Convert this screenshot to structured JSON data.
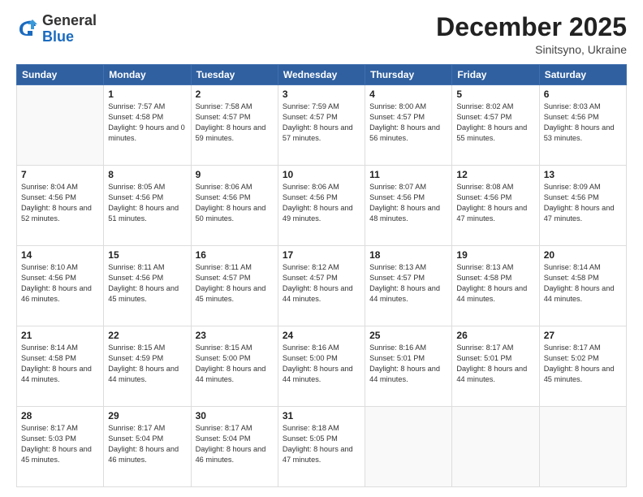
{
  "logo": {
    "general": "General",
    "blue": "Blue"
  },
  "header": {
    "month": "December 2025",
    "location": "Sinitsyno, Ukraine"
  },
  "days_of_week": [
    "Sunday",
    "Monday",
    "Tuesday",
    "Wednesday",
    "Thursday",
    "Friday",
    "Saturday"
  ],
  "weeks": [
    [
      {
        "day": "",
        "sunrise": "",
        "sunset": "",
        "daylight": ""
      },
      {
        "day": "1",
        "sunrise": "Sunrise: 7:57 AM",
        "sunset": "Sunset: 4:58 PM",
        "daylight": "Daylight: 9 hours and 0 minutes."
      },
      {
        "day": "2",
        "sunrise": "Sunrise: 7:58 AM",
        "sunset": "Sunset: 4:57 PM",
        "daylight": "Daylight: 8 hours and 59 minutes."
      },
      {
        "day": "3",
        "sunrise": "Sunrise: 7:59 AM",
        "sunset": "Sunset: 4:57 PM",
        "daylight": "Daylight: 8 hours and 57 minutes."
      },
      {
        "day": "4",
        "sunrise": "Sunrise: 8:00 AM",
        "sunset": "Sunset: 4:57 PM",
        "daylight": "Daylight: 8 hours and 56 minutes."
      },
      {
        "day": "5",
        "sunrise": "Sunrise: 8:02 AM",
        "sunset": "Sunset: 4:57 PM",
        "daylight": "Daylight: 8 hours and 55 minutes."
      },
      {
        "day": "6",
        "sunrise": "Sunrise: 8:03 AM",
        "sunset": "Sunset: 4:56 PM",
        "daylight": "Daylight: 8 hours and 53 minutes."
      }
    ],
    [
      {
        "day": "7",
        "sunrise": "Sunrise: 8:04 AM",
        "sunset": "Sunset: 4:56 PM",
        "daylight": "Daylight: 8 hours and 52 minutes."
      },
      {
        "day": "8",
        "sunrise": "Sunrise: 8:05 AM",
        "sunset": "Sunset: 4:56 PM",
        "daylight": "Daylight: 8 hours and 51 minutes."
      },
      {
        "day": "9",
        "sunrise": "Sunrise: 8:06 AM",
        "sunset": "Sunset: 4:56 PM",
        "daylight": "Daylight: 8 hours and 50 minutes."
      },
      {
        "day": "10",
        "sunrise": "Sunrise: 8:06 AM",
        "sunset": "Sunset: 4:56 PM",
        "daylight": "Daylight: 8 hours and 49 minutes."
      },
      {
        "day": "11",
        "sunrise": "Sunrise: 8:07 AM",
        "sunset": "Sunset: 4:56 PM",
        "daylight": "Daylight: 8 hours and 48 minutes."
      },
      {
        "day": "12",
        "sunrise": "Sunrise: 8:08 AM",
        "sunset": "Sunset: 4:56 PM",
        "daylight": "Daylight: 8 hours and 47 minutes."
      },
      {
        "day": "13",
        "sunrise": "Sunrise: 8:09 AM",
        "sunset": "Sunset: 4:56 PM",
        "daylight": "Daylight: 8 hours and 47 minutes."
      }
    ],
    [
      {
        "day": "14",
        "sunrise": "Sunrise: 8:10 AM",
        "sunset": "Sunset: 4:56 PM",
        "daylight": "Daylight: 8 hours and 46 minutes."
      },
      {
        "day": "15",
        "sunrise": "Sunrise: 8:11 AM",
        "sunset": "Sunset: 4:56 PM",
        "daylight": "Daylight: 8 hours and 45 minutes."
      },
      {
        "day": "16",
        "sunrise": "Sunrise: 8:11 AM",
        "sunset": "Sunset: 4:57 PM",
        "daylight": "Daylight: 8 hours and 45 minutes."
      },
      {
        "day": "17",
        "sunrise": "Sunrise: 8:12 AM",
        "sunset": "Sunset: 4:57 PM",
        "daylight": "Daylight: 8 hours and 44 minutes."
      },
      {
        "day": "18",
        "sunrise": "Sunrise: 8:13 AM",
        "sunset": "Sunset: 4:57 PM",
        "daylight": "Daylight: 8 hours and 44 minutes."
      },
      {
        "day": "19",
        "sunrise": "Sunrise: 8:13 AM",
        "sunset": "Sunset: 4:58 PM",
        "daylight": "Daylight: 8 hours and 44 minutes."
      },
      {
        "day": "20",
        "sunrise": "Sunrise: 8:14 AM",
        "sunset": "Sunset: 4:58 PM",
        "daylight": "Daylight: 8 hours and 44 minutes."
      }
    ],
    [
      {
        "day": "21",
        "sunrise": "Sunrise: 8:14 AM",
        "sunset": "Sunset: 4:58 PM",
        "daylight": "Daylight: 8 hours and 44 minutes."
      },
      {
        "day": "22",
        "sunrise": "Sunrise: 8:15 AM",
        "sunset": "Sunset: 4:59 PM",
        "daylight": "Daylight: 8 hours and 44 minutes."
      },
      {
        "day": "23",
        "sunrise": "Sunrise: 8:15 AM",
        "sunset": "Sunset: 5:00 PM",
        "daylight": "Daylight: 8 hours and 44 minutes."
      },
      {
        "day": "24",
        "sunrise": "Sunrise: 8:16 AM",
        "sunset": "Sunset: 5:00 PM",
        "daylight": "Daylight: 8 hours and 44 minutes."
      },
      {
        "day": "25",
        "sunrise": "Sunrise: 8:16 AM",
        "sunset": "Sunset: 5:01 PM",
        "daylight": "Daylight: 8 hours and 44 minutes."
      },
      {
        "day": "26",
        "sunrise": "Sunrise: 8:17 AM",
        "sunset": "Sunset: 5:01 PM",
        "daylight": "Daylight: 8 hours and 44 minutes."
      },
      {
        "day": "27",
        "sunrise": "Sunrise: 8:17 AM",
        "sunset": "Sunset: 5:02 PM",
        "daylight": "Daylight: 8 hours and 45 minutes."
      }
    ],
    [
      {
        "day": "28",
        "sunrise": "Sunrise: 8:17 AM",
        "sunset": "Sunset: 5:03 PM",
        "daylight": "Daylight: 8 hours and 45 minutes."
      },
      {
        "day": "29",
        "sunrise": "Sunrise: 8:17 AM",
        "sunset": "Sunset: 5:04 PM",
        "daylight": "Daylight: 8 hours and 46 minutes."
      },
      {
        "day": "30",
        "sunrise": "Sunrise: 8:17 AM",
        "sunset": "Sunset: 5:04 PM",
        "daylight": "Daylight: 8 hours and 46 minutes."
      },
      {
        "day": "31",
        "sunrise": "Sunrise: 8:18 AM",
        "sunset": "Sunset: 5:05 PM",
        "daylight": "Daylight: 8 hours and 47 minutes."
      },
      {
        "day": "",
        "sunrise": "",
        "sunset": "",
        "daylight": ""
      },
      {
        "day": "",
        "sunrise": "",
        "sunset": "",
        "daylight": ""
      },
      {
        "day": "",
        "sunrise": "",
        "sunset": "",
        "daylight": ""
      }
    ]
  ]
}
